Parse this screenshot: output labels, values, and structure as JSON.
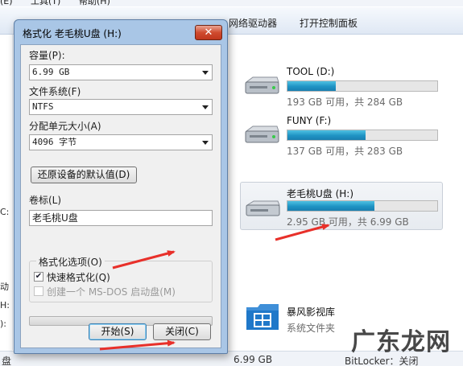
{
  "explorer": {
    "menu": [
      "编辑(E)",
      "工具(T)",
      "帮助(H)"
    ],
    "commands": [
      "网络驱动器",
      "打开控制面板"
    ],
    "left_fragments": [
      "C:",
      "动",
      "H:",
      "):"
    ],
    "drives": [
      {
        "name": "TOOL (D:)",
        "space": "193 GB 可用，共 284 GB",
        "used_fraction": 0.32
      },
      {
        "name": "FUNY (F:)",
        "space": "137 GB 可用，共 283 GB",
        "used_fraction": 0.52
      },
      {
        "name": "老毛桃U盘 (H:)",
        "space": "2.95 GB 可用，共 6.99 GB",
        "used_fraction": 0.58
      }
    ],
    "library": {
      "name": "暴风影视库",
      "type": "系统文件夹"
    },
    "status": {
      "left": "盘",
      "size": "6.99 GB",
      "bitlocker": "BitLocker：关闭"
    }
  },
  "dialog": {
    "title": "格式化 老毛桃U盘 (H:)",
    "close_glyph": "✕",
    "capacity_label": "容量(P):",
    "capacity_value": "6.99 GB",
    "filesystem_label": "文件系统(F)",
    "filesystem_value": "NTFS",
    "allocation_label": "分配单元大小(A)",
    "allocation_value": "4096 字节",
    "restore_button": "还原设备的默认值(D)",
    "volume_label": "卷标(L)",
    "volume_value": "老毛桃U盘",
    "options_title": "格式化选项(O)",
    "quick_format": "快速格式化(Q)",
    "quick_format_checked": true,
    "msdos_disk": "创建一个 MS-DOS 启动盘(M)",
    "msdos_checked": false,
    "start_button": "开始(S)",
    "close_button": "关闭(C)"
  },
  "watermark": "广东龙网",
  "colors": {
    "drive_bar": "#1f93c4",
    "title_bar": "#a9c6e6",
    "close_button": "#d04b2e",
    "arrow": "#e8302a"
  }
}
